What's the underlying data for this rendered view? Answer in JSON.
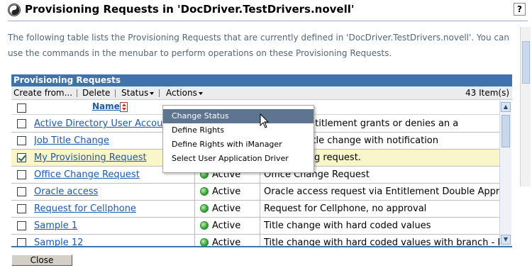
{
  "header": {
    "title": "Provisioning Requests in 'DocDriver.TestDrivers.novell'",
    "help_label": "?"
  },
  "description": "The following table lists the Provisioning Requests that are currently defined in 'DocDriver.TestDrivers.novell'. You can use the commands in the menubar to perform operations on these Provisioning Requests.",
  "table": {
    "title": "Provisioning Requests",
    "menu": {
      "create_from": "Create from...",
      "delete": "Delete",
      "status": "Status",
      "actions": "Actions",
      "item_count": "43 Item(s)"
    },
    "columns": {
      "name": "Name"
    },
    "rows": [
      {
        "name": "Active Directory User Account",
        "status": "",
        "description": "account entitlement grants or denies an a",
        "checked": false,
        "selected": false
      },
      {
        "name": "Job Title Change",
        "status": "",
        "description": "oval, Job title change with notification",
        "checked": false,
        "selected": false
      },
      {
        "name": "My Provisioning Request",
        "status": "",
        "description": "provisioning request.",
        "checked": true,
        "selected": true
      },
      {
        "name": "Office Change Request",
        "status": "Active",
        "description": "Office Change Request",
        "checked": false,
        "selected": false
      },
      {
        "name": "Oracle access",
        "status": "Active",
        "description": "Oracle access request via Entitlement Double Approval",
        "checked": false,
        "selected": false
      },
      {
        "name": "Request for Cellphone",
        "status": "Active",
        "description": "Request for Cellphone, no approval",
        "checked": false,
        "selected": false
      },
      {
        "name": "Sample 1",
        "status": "Active",
        "description": "Title change with hard coded values",
        "checked": false,
        "selected": false
      },
      {
        "name": "Sample 12",
        "status": "Active",
        "description": "Title change with hard coded values with branch - R",
        "checked": false,
        "selected": false
      }
    ]
  },
  "actions_menu": {
    "items": [
      "Change Status",
      "Define Rights",
      "Define Rights with iManager",
      "Select User Application Driver"
    ],
    "highlighted": "Change Status"
  },
  "footer": {
    "close_label": "Close"
  }
}
